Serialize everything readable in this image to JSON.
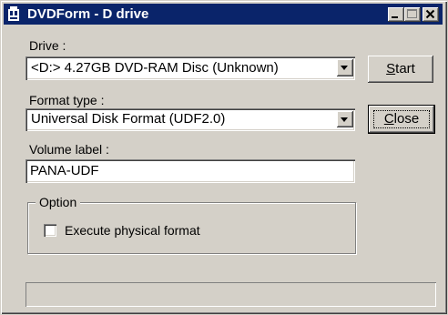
{
  "window": {
    "title": "DVDForm - D drive",
    "title_icon": "dvd-app-icon",
    "minimize_icon": "minimize-icon",
    "maximize_icon": "maximize-icon",
    "close_icon": "close-icon"
  },
  "drive": {
    "label": "Drive :",
    "selected": "<D:> 4.27GB DVD-RAM Disc (Unknown)"
  },
  "format_type": {
    "label": "Format type :",
    "selected": "Universal Disk Format (UDF2.0)"
  },
  "volume_label": {
    "label": "Volume label :",
    "value": "PANA-UDF"
  },
  "option": {
    "title": "Option",
    "checkbox_label": "Execute physical format",
    "checked": false
  },
  "buttons": {
    "start_mnemonic": "S",
    "start_rest": "tart",
    "close_mnemonic": "C",
    "close_rest": "lose"
  },
  "colors": {
    "titlebar": "#0a246a",
    "face": "#d4d0c8"
  }
}
